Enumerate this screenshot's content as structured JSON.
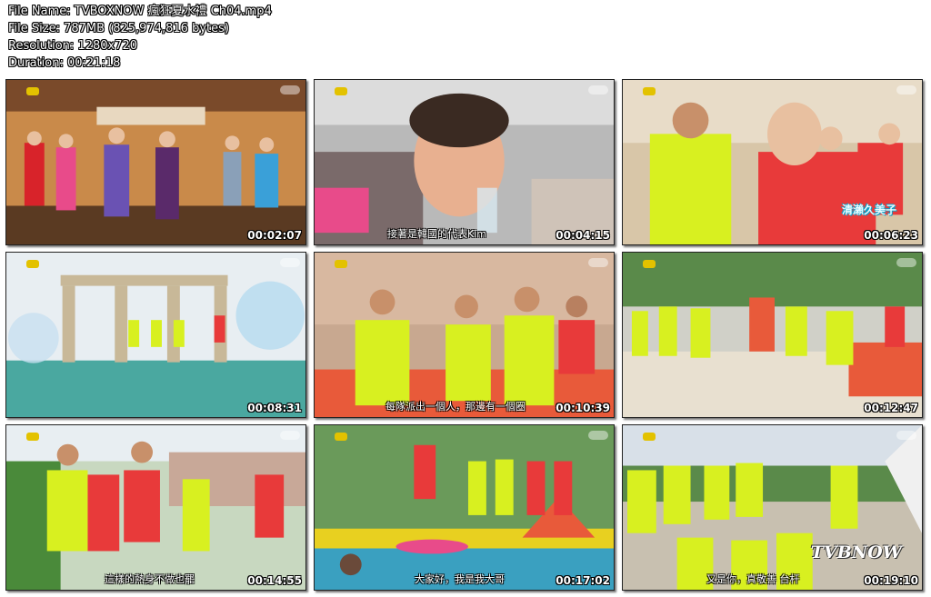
{
  "file_info": {
    "name_line": "File Name: TVBOXNOW 瘋狂夏水禮 Ch04.mp4",
    "size_line": "File Size: 787MB (825,974,816 bytes)",
    "resolution_line": "Resolution: 1280x720",
    "duration_line": "Duration: 00:21:18"
  },
  "thumbnails": [
    {
      "timestamp": "00:02:07",
      "subtitle": ""
    },
    {
      "timestamp": "00:04:15",
      "subtitle": "接著是韓國的代表Kim"
    },
    {
      "timestamp": "00:06:23",
      "subtitle": "",
      "name_caption": "清瀨久美子"
    },
    {
      "timestamp": "00:08:31",
      "subtitle": ""
    },
    {
      "timestamp": "00:10:39",
      "subtitle": "每隊派出一個人，那邊有一個圈"
    },
    {
      "timestamp": "00:12:47",
      "subtitle": ""
    },
    {
      "timestamp": "00:14:55",
      "subtitle": "這樣的熱身不做也罷"
    },
    {
      "timestamp": "00:17:02",
      "subtitle": "大家好，我是我大哥"
    },
    {
      "timestamp": "00:19:10",
      "subtitle": "又是你，真敬善 台杆",
      "watermark": "TVBNOW"
    }
  ]
}
